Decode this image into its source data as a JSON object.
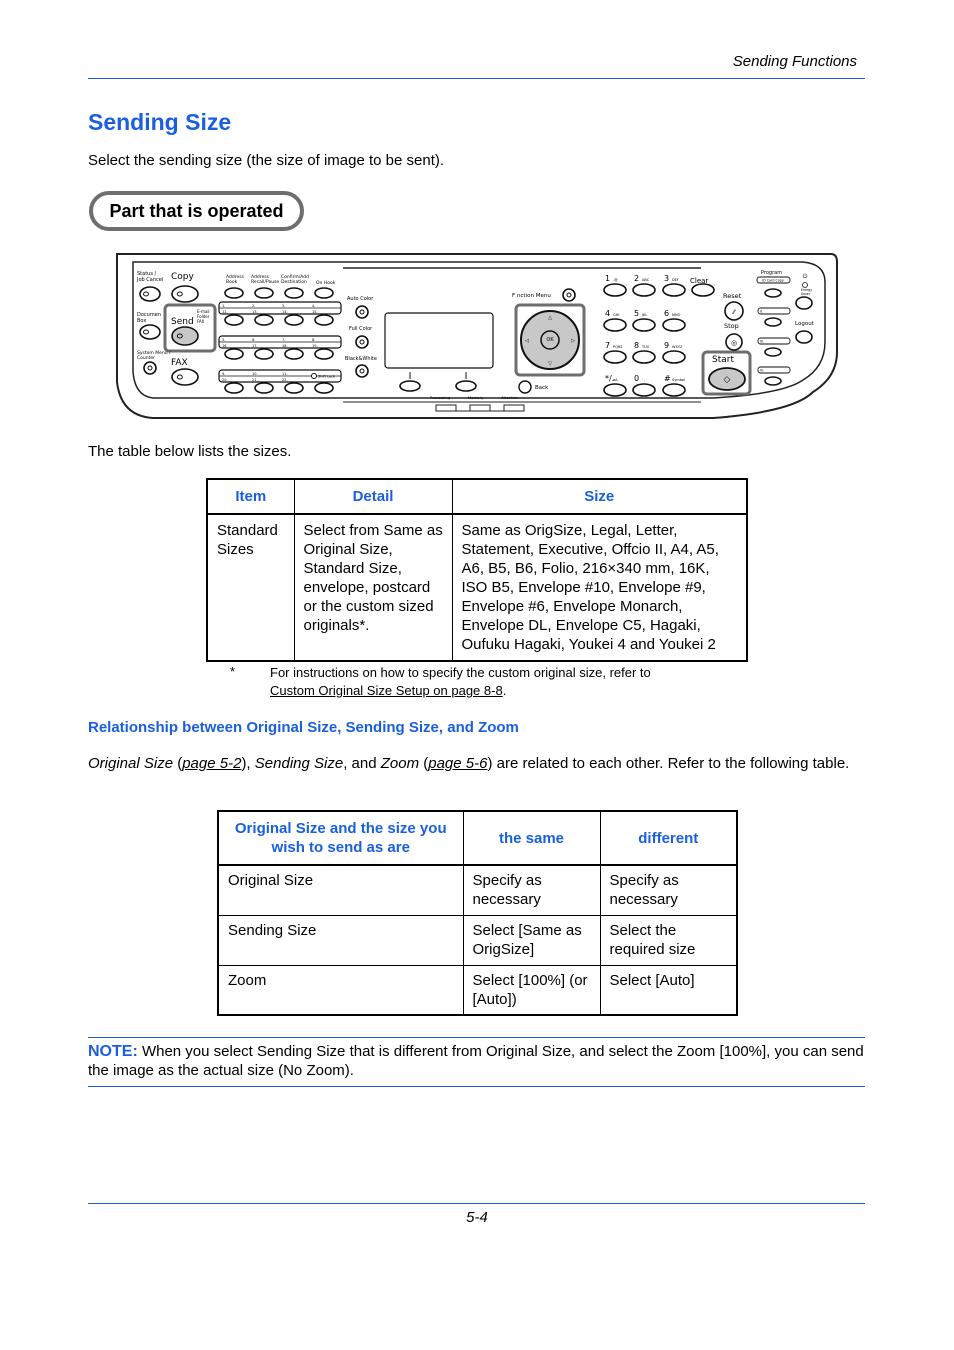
{
  "header": {
    "section": "Sending Functions"
  },
  "page": {
    "title": "Sending Size",
    "intro": "Select the sending size (the size of image to be sent).",
    "part_label": "Part that is operated",
    "table_intro": "The table below lists the sizes.",
    "page_number": "5-4"
  },
  "panel": {
    "labels": {
      "status": [
        "Status /",
        "Job Cancel"
      ],
      "copy": "Copy",
      "document_box": [
        "Documen",
        "Box"
      ],
      "send": "Send",
      "send_sub": [
        "E-mail",
        "Folder",
        "FAX"
      ],
      "system_menu": [
        "System Menu /",
        "Counter"
      ],
      "fax": "FAX",
      "address_book": [
        "Address",
        "Book"
      ],
      "address_recall": [
        "Address",
        "Recall/Pause"
      ],
      "confirm_add": [
        "Confirm/Add",
        "Destination"
      ],
      "on_hook": "On Hook",
      "one_touch_rows": [
        [
          "1.",
          "2.",
          "3.",
          "4."
        ],
        [
          "12.",
          "13.",
          "14.",
          "15."
        ],
        [
          "5.",
          "6.",
          "7.",
          "8."
        ],
        [
          "16.",
          "17.",
          "18.",
          "19."
        ],
        [
          "9.",
          "10.",
          "11.",
          ""
        ],
        [
          "20.",
          "21.",
          "22.",
          ""
        ]
      ],
      "shift_lock": "Shift Lock",
      "auto_color": "Auto Color",
      "full_color": "Full Color",
      "black_white": "Black&White",
      "function_menu": "F nction Menu",
      "ok": "OK",
      "back": "Back",
      "processing": "Processing",
      "memory": "Memory",
      "attention": "Attention",
      "keys": [
        {
          "d": "1",
          "s": ".@"
        },
        {
          "d": "2",
          "s": "ABC"
        },
        {
          "d": "3",
          "s": "DEF"
        },
        {
          "d": "4",
          "s": "GHI"
        },
        {
          "d": "5",
          "s": "JKL"
        },
        {
          "d": "6",
          "s": "MNO"
        },
        {
          "d": "7",
          "s": "PQRS"
        },
        {
          "d": "8",
          "s": "TUV"
        },
        {
          "d": "9",
          "s": "WXYZ"
        },
        {
          "d": "*/.",
          "s": "aA"
        },
        {
          "d": "0",
          "s": "· ,"
        },
        {
          "d": "#",
          "s": "Symbol"
        }
      ],
      "clear": "Clear",
      "reset": "Reset",
      "stop": "Stop",
      "start": "Start",
      "program": "Program",
      "id_card_copy": "ID Card Copy",
      "energy_saver": [
        "Energy",
        "Saver"
      ],
      "logout": "Logout",
      "prog_keys": [
        "II.",
        "III.",
        "IV."
      ]
    }
  },
  "sizes_table": {
    "headers": [
      "Item",
      "Detail",
      "Size"
    ],
    "rows": [
      {
        "item": "Standard Sizes",
        "detail": "Select from Same as Original Size, Standard Size, envelope, postcard or the custom sized originals*.",
        "size": "Same as OrigSize, Legal, Letter, Statement, Executive, Offcio II, A4, A5, A6, B5,  B6, Folio, 216×340 mm, 16K, ISO B5, Envelope #10, Envelope #9, Envelope #6, Envelope Monarch, Envelope DL, Envelope C5, Hagaki, Oufuku Hagaki, Youkei 4 and Youkei 2"
      }
    ]
  },
  "footnote": {
    "mark": "*",
    "text": "For instructions on how to specify the custom original size, refer to",
    "link": "Custom Original Size Setup on page 8-8",
    "suffix": "."
  },
  "relationship": {
    "heading": "Relationship between Original Size, Sending Size, and Zoom",
    "para": {
      "t1": "Original Size",
      "t2": " (",
      "link1": "page 5-2",
      "t3": "), ",
      "t4": "Sending Size",
      "t5": ", and ",
      "t6": "Zoom",
      "t7": " (",
      "link2": "page 5-6",
      "t8": ") are related to each other. Refer to the following table."
    },
    "table": {
      "headers": [
        "Original Size and the size you wish to send as are",
        "the same",
        "different"
      ],
      "rows": [
        [
          "Original Size",
          "Specify as necessary",
          "Specify as necessary"
        ],
        [
          "Sending Size",
          "Select [Same as OrigSize]",
          "Select the required size"
        ],
        [
          "Zoom",
          "Select [100%] (or [Auto])",
          "Select [Auto]"
        ]
      ]
    }
  },
  "note": {
    "label": "NOTE:",
    "text": " When you select Sending Size that is different from Original Size, and select the Zoom [100%], you can send the image as the actual size (No Zoom)."
  },
  "colors": {
    "accent": "#1a5fe0",
    "rule": "#1f5fc8",
    "highlight_border": "#6e6e6e",
    "button_fill": "#c8c8c8"
  }
}
